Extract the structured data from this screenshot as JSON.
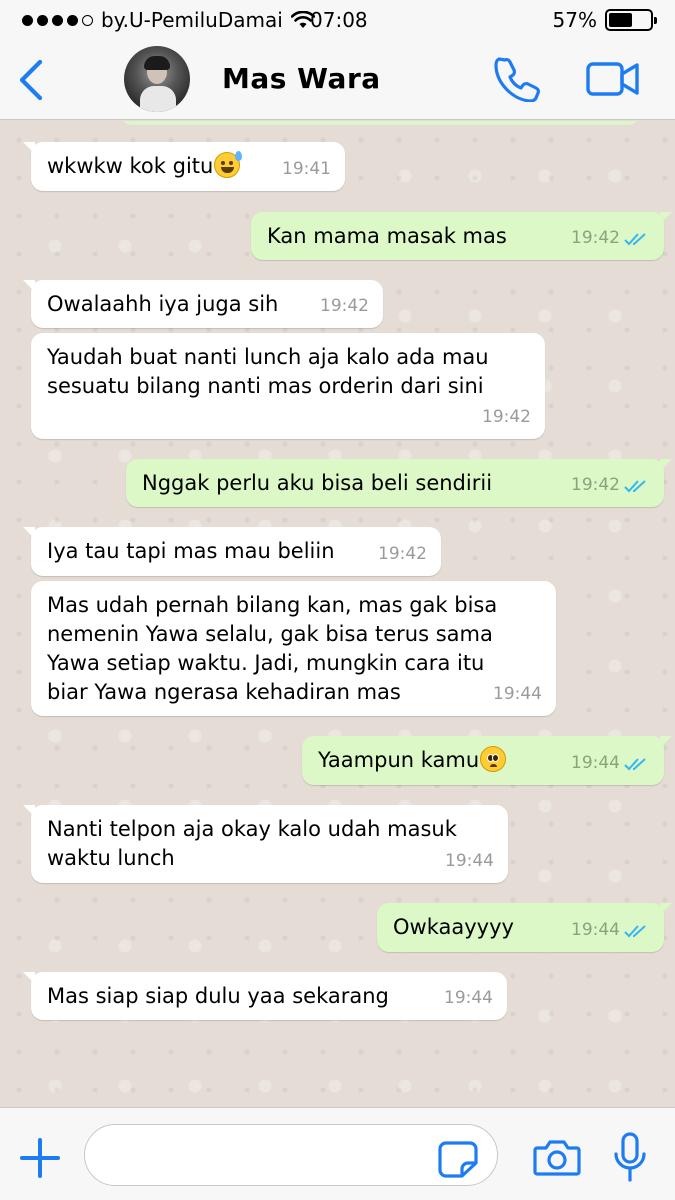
{
  "status_bar": {
    "carrier": "by.U-PemiluDamai",
    "time": "07:08",
    "battery": "57%"
  },
  "header": {
    "back_icon": "chevron-left-icon",
    "contact_name": "Mas Wara",
    "call_icon": "phone-icon",
    "video_icon": "video-camera-icon",
    "accent_color": "#1e7cf2"
  },
  "messages": [
    {
      "dir": "in",
      "text": "wkwkw kok gitu",
      "emoji": "sweat-smile",
      "time": "19:41"
    },
    {
      "dir": "out",
      "text": "Kan mama masak mas",
      "time": "19:42",
      "status": "read"
    },
    {
      "dir": "in",
      "text": "Owalaahh iya juga sih",
      "time": "19:42"
    },
    {
      "dir": "in",
      "text": "Yaudah buat nanti lunch aja kalo ada mau\nsesuatu bilang nanti mas orderin dari sini",
      "time": "19:42"
    },
    {
      "dir": "out",
      "text": "Nggak perlu aku bisa beli sendirii",
      "time": "19:42",
      "status": "read"
    },
    {
      "dir": "in",
      "text": "Iya tau tapi mas mau beliin",
      "time": "19:42"
    },
    {
      "dir": "in",
      "text": "Mas udah pernah bilang kan, mas gak bisa\nnemenin Yawa selalu, gak bisa terus sama\nYawa setiap waktu. Jadi, mungkin cara itu\nbiar Yawa ngerasa kehadiran mas",
      "time": "19:44"
    },
    {
      "dir": "out",
      "text": "Yaampun kamu",
      "emoji": "pleading-face",
      "time": "19:44",
      "status": "read"
    },
    {
      "dir": "in",
      "text": "Nanti telpon aja okay kalo udah masuk\nwaktu lunch",
      "time": "19:44"
    },
    {
      "dir": "out",
      "text": "Owkaayyyy",
      "time": "19:44",
      "status": "read"
    },
    {
      "dir": "in",
      "text": "Mas siap siap dulu yaa sekarang",
      "time": "19:44"
    }
  ],
  "composer": {
    "placeholder": "",
    "icons": [
      "plus-icon",
      "sticker-icon",
      "camera-icon",
      "microphone-icon"
    ]
  },
  "colors": {
    "incoming_bubble": "#ffffff",
    "outgoing_bubble": "#dcf8c6",
    "read_ticks": "#34b7f1",
    "chat_background": "#e5ddd5"
  }
}
